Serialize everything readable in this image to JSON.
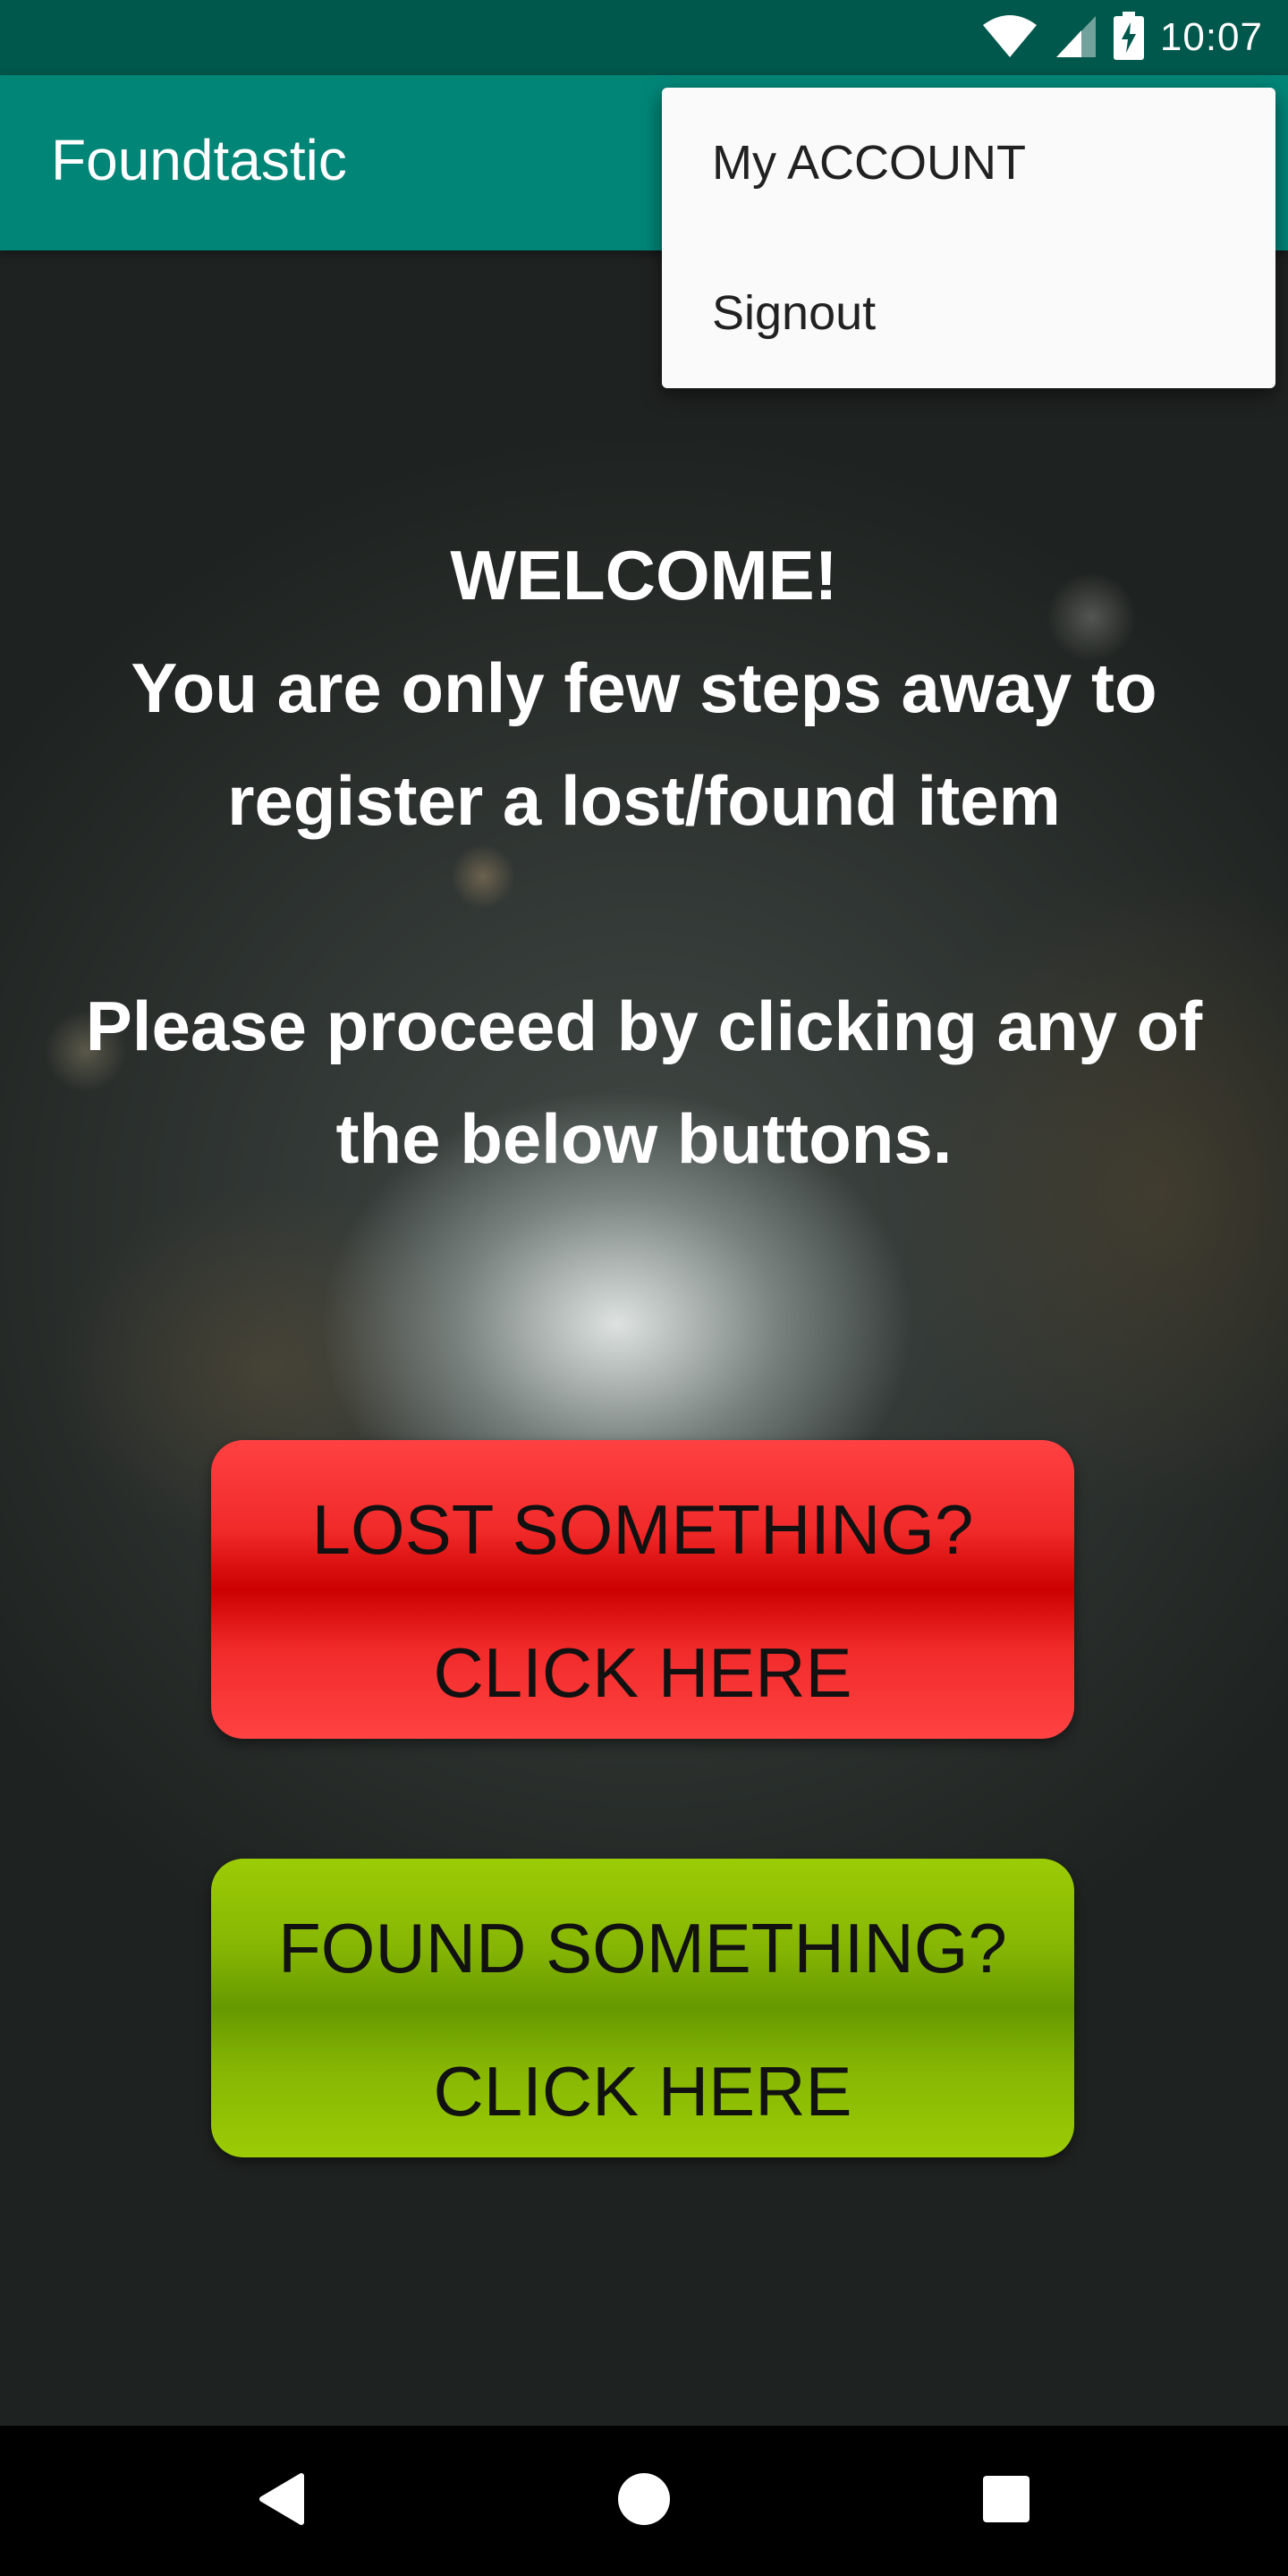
{
  "status_bar": {
    "time": "10:07",
    "icons": [
      "wifi-icon",
      "cell-signal-icon",
      "battery-charging-icon"
    ]
  },
  "app_bar": {
    "title": "Foundtastic"
  },
  "overflow_menu": {
    "items": [
      {
        "label": "My ACCOUNT"
      },
      {
        "label": "Signout"
      }
    ]
  },
  "welcome": {
    "line1": "WELCOME!",
    "line2": "You are only few steps away to",
    "line3": "register a lost/found item",
    "line4": "Please proceed by clicking any of",
    "line5": "the below buttons."
  },
  "buttons": {
    "lost": {
      "line1": "LOST SOMETHING?",
      "line2": "CLICK HERE"
    },
    "found": {
      "line1": "FOUND SOMETHING?",
      "line2": "CLICK HERE"
    }
  },
  "nav_bar": {
    "icons": [
      "back-icon",
      "home-icon",
      "recents-icon"
    ]
  },
  "colors": {
    "status_bar": "#00574b",
    "app_bar": "#008577",
    "lost_button": "#cc0000",
    "found_button": "#669900",
    "menu_background": "#fafafa"
  }
}
